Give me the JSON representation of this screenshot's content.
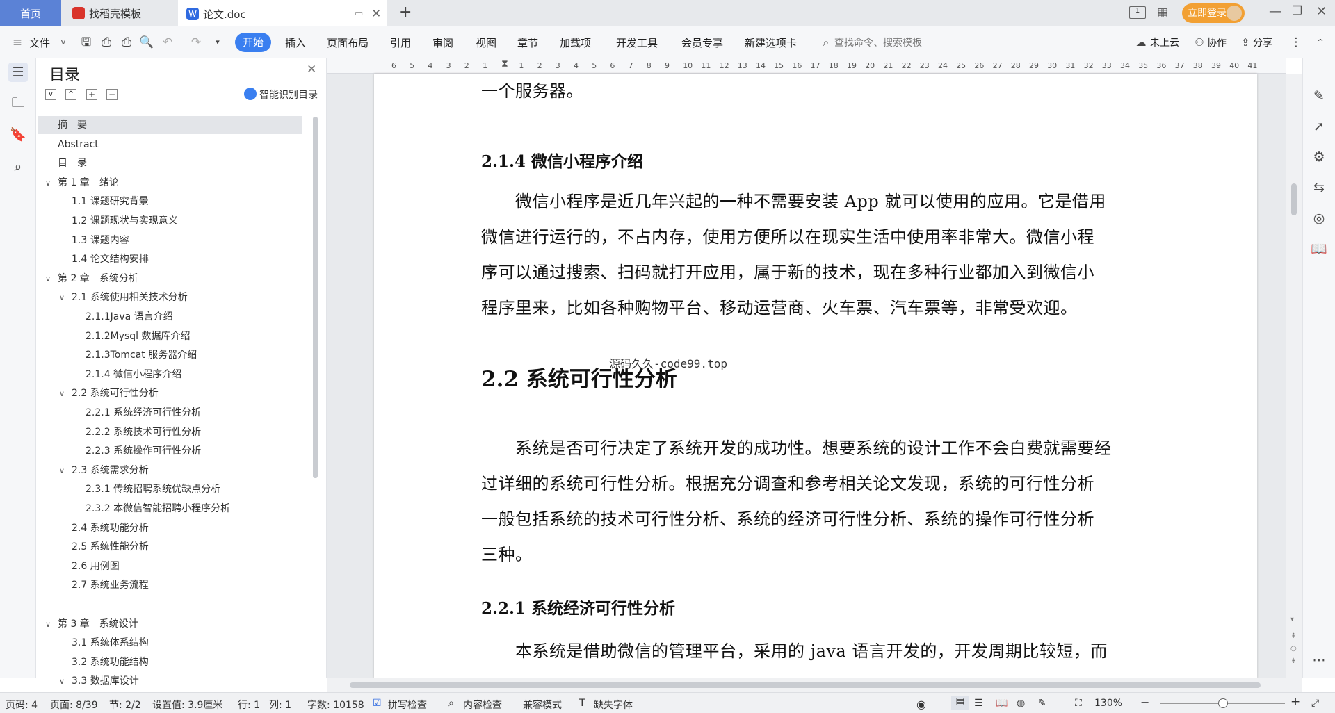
{
  "tabs": {
    "home": "首页",
    "template": "找稻壳模板",
    "doc": "论文.doc"
  },
  "window": {
    "login": "立即登录"
  },
  "toolbar": {
    "file": "文件",
    "start": "开始",
    "items": [
      "插入",
      "页面布局",
      "引用",
      "审阅",
      "视图",
      "章节",
      "加载项",
      "开发工具",
      "会员专享",
      "新建选项卡"
    ],
    "search_placeholder": "查找命令、搜索模板",
    "cloud": "未上云",
    "collab": "协作",
    "share": "分享"
  },
  "toc": {
    "title": "目录",
    "smart": "智能识别目录",
    "items": [
      {
        "label": "摘　要",
        "level": 0,
        "chev": ""
      },
      {
        "label": "Abstract",
        "level": 0,
        "chev": ""
      },
      {
        "label": "目　录",
        "level": 0,
        "chev": ""
      },
      {
        "label": "第 1 章　绪论",
        "level": 0,
        "chev": "v"
      },
      {
        "label": "1.1 课题研究背景",
        "level": 1,
        "chev": ""
      },
      {
        "label": "1.2 课题现状与实现意义",
        "level": 1,
        "chev": ""
      },
      {
        "label": "1.3 课题内容",
        "level": 1,
        "chev": ""
      },
      {
        "label": "1.4 论文结构安排",
        "level": 1,
        "chev": ""
      },
      {
        "label": "第 2 章　系统分析",
        "level": 0,
        "chev": "v"
      },
      {
        "label": "2.1 系统使用相关技术分析",
        "level": 1,
        "chev": "v"
      },
      {
        "label": "2.1.1Java 语言介绍",
        "level": 2,
        "chev": ""
      },
      {
        "label": "2.1.2Mysql 数据库介绍",
        "level": 2,
        "chev": ""
      },
      {
        "label": "2.1.3Tomcat 服务器介绍",
        "level": 2,
        "chev": ""
      },
      {
        "label": "2.1.4 微信小程序介绍",
        "level": 2,
        "chev": ""
      },
      {
        "label": "2.2 系统可行性分析",
        "level": 1,
        "chev": "v"
      },
      {
        "label": "2.2.1 系统经济可行性分析",
        "level": 2,
        "chev": ""
      },
      {
        "label": "2.2.2 系统技术可行性分析",
        "level": 2,
        "chev": ""
      },
      {
        "label": "2.2.3 系统操作可行性分析",
        "level": 2,
        "chev": ""
      },
      {
        "label": "2.3 系统需求分析",
        "level": 1,
        "chev": "v"
      },
      {
        "label": "2.3.1 传统招聘系统优缺点分析",
        "level": 2,
        "chev": ""
      },
      {
        "label": "2.3.2 本微信智能招聘小程序分析",
        "level": 2,
        "chev": ""
      },
      {
        "label": "2.4 系统功能分析",
        "level": 1,
        "chev": ""
      },
      {
        "label": "2.5 系统性能分析",
        "level": 1,
        "chev": ""
      },
      {
        "label": "2.6 用例图",
        "level": 1,
        "chev": ""
      },
      {
        "label": "2.7 系统业务流程",
        "level": 1,
        "chev": ""
      },
      {
        "label": "第 3 章　系统设计",
        "level": 0,
        "chev": "v"
      },
      {
        "label": "3.1 系统体系结构",
        "level": 1,
        "chev": ""
      },
      {
        "label": "3.2 系统功能结构",
        "level": 1,
        "chev": ""
      },
      {
        "label": "3.3 数据库设计",
        "level": 1,
        "chev": "v"
      }
    ]
  },
  "ruler": [
    "6",
    "5",
    "4",
    "3",
    "2",
    "1",
    "",
    "1",
    "2",
    "3",
    "4",
    "5",
    "6",
    "7",
    "8",
    "9",
    "10",
    "11",
    "12",
    "13",
    "14",
    "15",
    "16",
    "17",
    "18",
    "19",
    "20",
    "21",
    "22",
    "23",
    "24",
    "25",
    "26",
    "27",
    "28",
    "29",
    "30",
    "31",
    "32",
    "33",
    "34",
    "35",
    "36",
    "37",
    "38",
    "39",
    "40",
    "41"
  ],
  "doc": {
    "line0": "一个服务器。",
    "h214": "2.1.4 微信小程序介绍",
    "p1": [
      "　　微信小程序是近几年兴起的一种不需要安装 App 就可以使用的应用。它是借用",
      "微信进行运行的，不占内存，使用方便所以在现实生活中使用率非常大。微信小程",
      "序可以通过搜索、扫码就打开应用，属于新的技术，现在多种行业都加入到微信小",
      "程序里来，比如各种购物平台、移动运营商、火车票、汽车票等，非常受欢迎。"
    ],
    "watermark": "源码久久-code99.top",
    "h22": "2.2 系统可行性分析",
    "p2": [
      "　　系统是否可行决定了系统开发的成功性。想要系统的设计工作不会白费就需要经",
      "过详细的系统可行性分析。根据充分调查和参考相关论文发现，系统的可行性分析",
      "一般包括系统的技术可行性分析、系统的经济可行性分析、系统的操作可行性分析",
      "三种。"
    ],
    "h221": "2.2.1 系统经济可行性分析",
    "p3": "　　本系统是借助微信的管理平台，采用的 java 语言开发的，开发周期比较短，而"
  },
  "status": {
    "pageno": "页码: 4",
    "page": "页面: 8/39",
    "section": "节: 2/2",
    "setting": "设置值: 3.9厘米",
    "row": "行: 1",
    "col": "列: 1",
    "words": "字数: 10158",
    "spell": "拼写检查",
    "content": "内容检查",
    "compat": "兼容模式",
    "font": "缺失字体",
    "zoom": "130%"
  }
}
